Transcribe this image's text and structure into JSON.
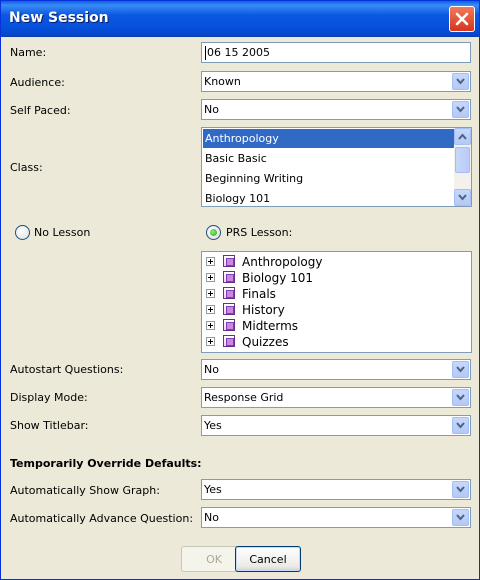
{
  "window": {
    "title": "New Session"
  },
  "form": {
    "name": {
      "label": "Name:",
      "value": "06 15 2005"
    },
    "audience": {
      "label": "Audience:",
      "value": "Known"
    },
    "self_paced": {
      "label": "Self Paced:",
      "value": "No"
    },
    "class": {
      "label": "Class:",
      "items": [
        "Anthropology",
        "Basic Basic",
        "Beginning Writing",
        "Biology 101"
      ],
      "selected_index": 0
    },
    "lesson_mode": {
      "no_lesson_label": "No Lesson",
      "prs_lesson_label": "PRS Lesson:",
      "selected": "prs_lesson"
    },
    "lessons": [
      "Anthropology",
      "Biology 101",
      "Finals",
      "History",
      "Midterms",
      "Quizzes"
    ],
    "autostart": {
      "label": "Autostart Questions:",
      "value": "No"
    },
    "display_mode": {
      "label": "Display Mode:",
      "value": "Response Grid"
    },
    "show_titlebar": {
      "label": "Show Titlebar:",
      "value": "Yes"
    },
    "override_heading": "Temporarily Override Defaults:",
    "auto_show_graph": {
      "label": "Automatically Show Graph:",
      "value": "Yes"
    },
    "auto_advance": {
      "label": "Automatically Advance Question:",
      "value": "No"
    }
  },
  "buttons": {
    "ok": "OK",
    "cancel": "Cancel"
  },
  "icons": {
    "close": "close-icon",
    "dropdown": "chevron-down-icon",
    "expand": "plus-box-icon",
    "lesson": "lesson-book-icon"
  },
  "colors": {
    "titlebar": "#0550dc",
    "selection": "#316ac5",
    "dialog_bg": "#ece9d8",
    "field_border": "#7f9db9"
  }
}
